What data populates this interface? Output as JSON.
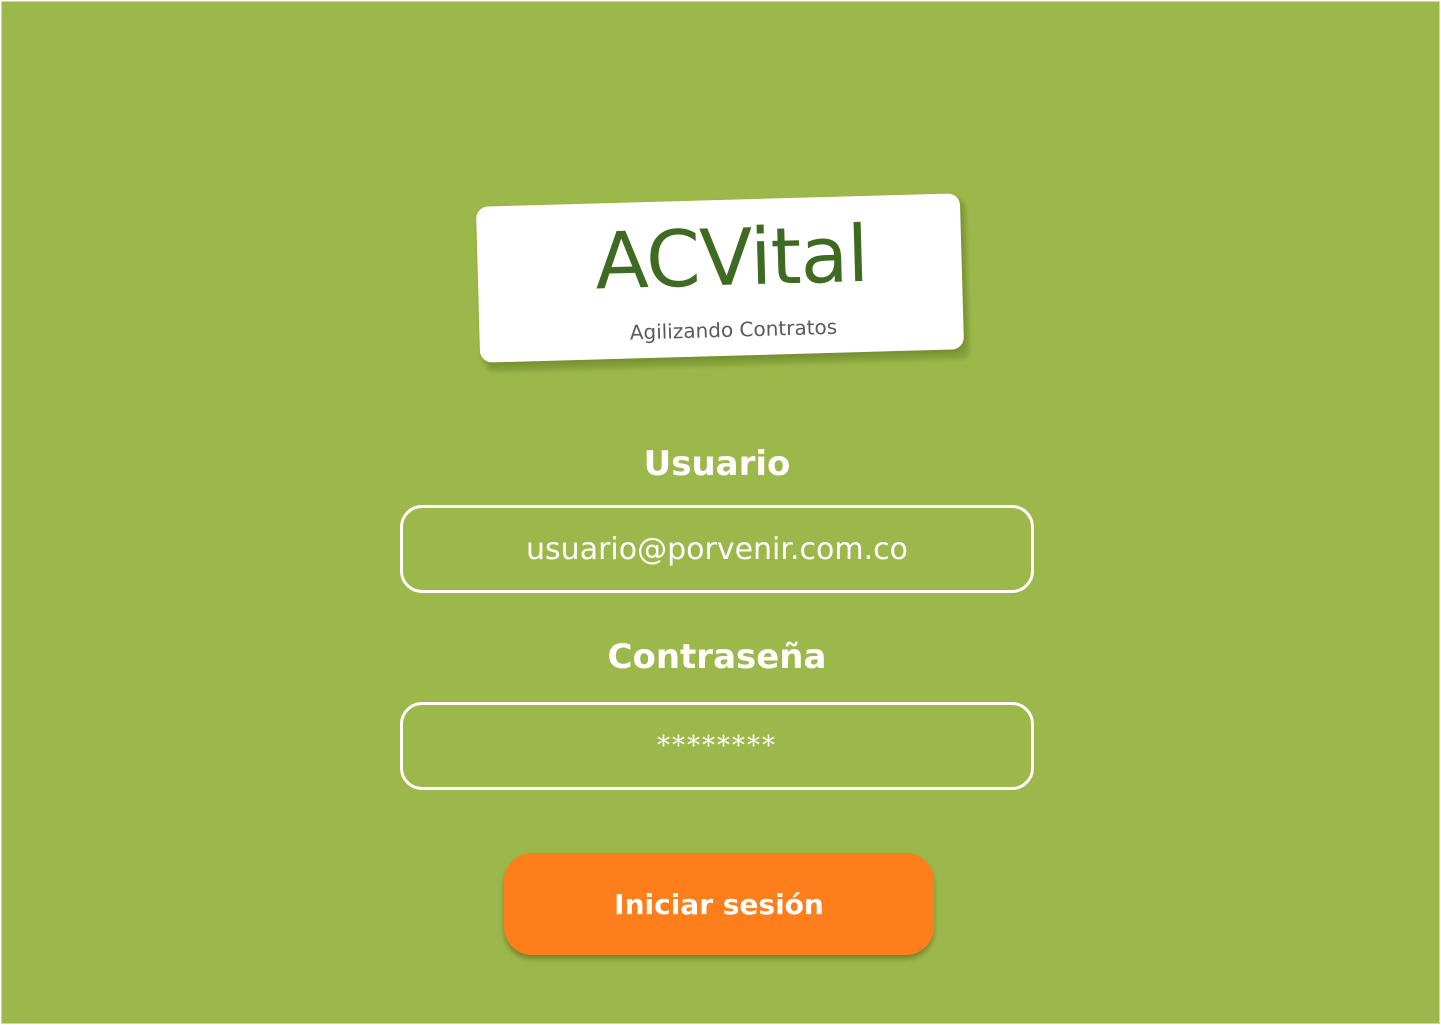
{
  "logo": {
    "title": "ACVital",
    "subtitle": "Agilizando Contratos"
  },
  "form": {
    "user_label": "Usuario",
    "user_value": "usuario@porvenir.com.co",
    "password_label": "Contraseña",
    "password_value": "********",
    "submit_label": "Iniciar sesión"
  },
  "colors": {
    "background": "#9db84a",
    "logo_green": "#3f6a21",
    "button": "#fd7e1a"
  }
}
